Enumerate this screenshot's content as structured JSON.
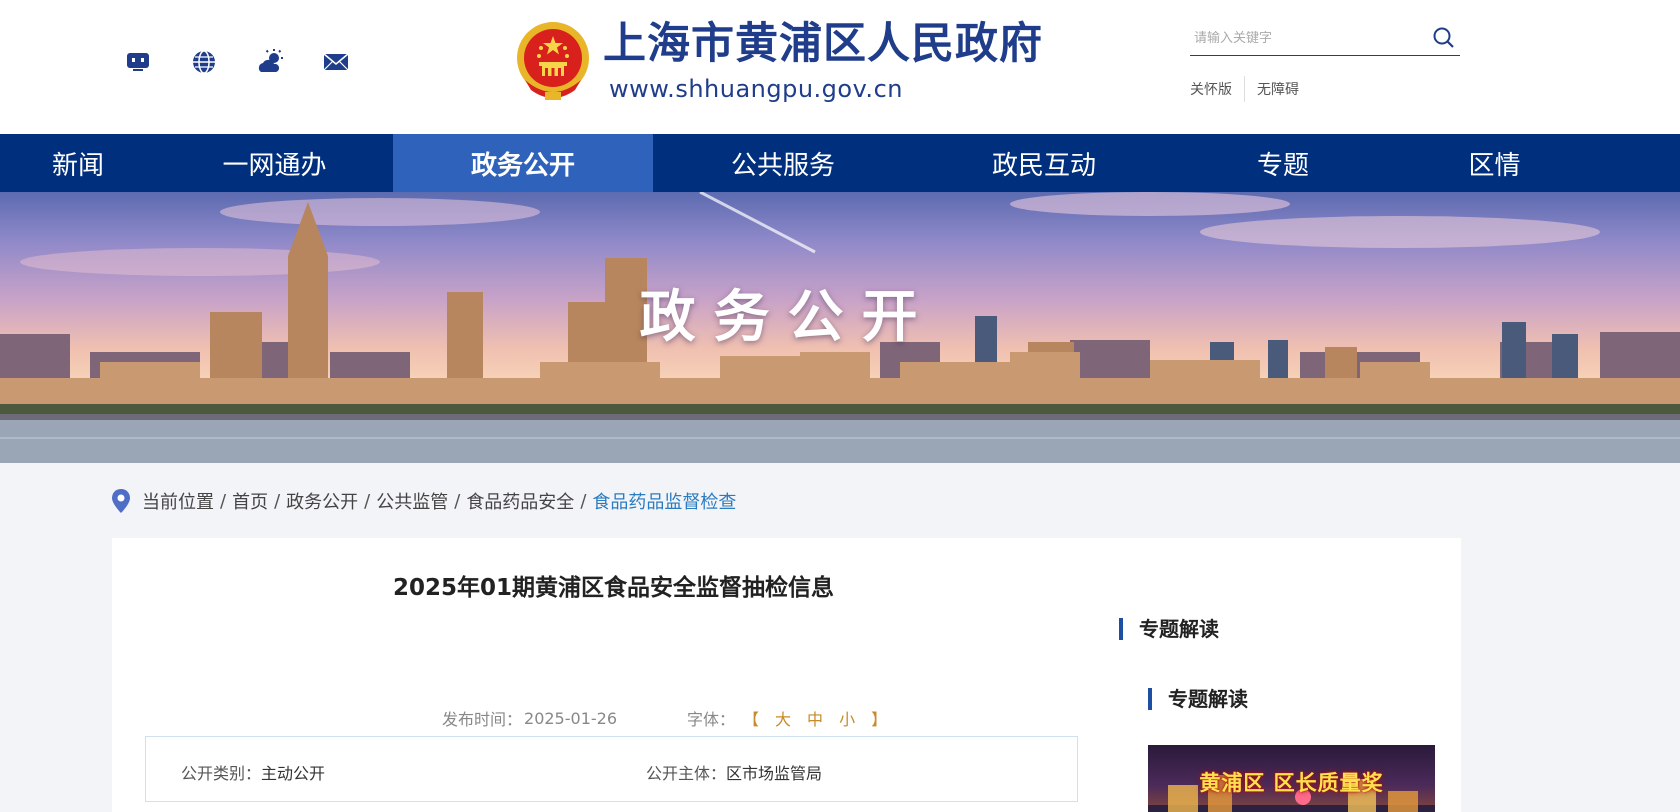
{
  "header": {
    "site_title": "上海市黄浦区人民政府",
    "site_url": "www.shhuangpu.gov.cn",
    "quick_icons": [
      "miniprogram-icon",
      "globe-icon",
      "weather-icon",
      "mail-icon"
    ],
    "search": {
      "placeholder": "请输入关键字"
    },
    "links": {
      "care": "关怀版",
      "accessibility": "无障碍"
    }
  },
  "nav": {
    "items": [
      {
        "label": "新闻"
      },
      {
        "label": "一网通办"
      },
      {
        "label": "政务公开",
        "active": true
      },
      {
        "label": "公共服务"
      },
      {
        "label": "政民互动"
      },
      {
        "label": "专题"
      },
      {
        "label": "区情"
      }
    ]
  },
  "banner": {
    "title": "政务公开"
  },
  "breadcrumb": {
    "prefix": "当前位置",
    "items": [
      "首页",
      "政务公开",
      "公共监管",
      "食品药品安全"
    ],
    "current": "食品药品监督检查"
  },
  "article": {
    "title": "2025年01期黄浦区食品安全监督抽检信息",
    "publish_label": "发布时间：",
    "publish_date": "2025-01-26",
    "font_label": "字体：",
    "font_open": "【",
    "font_close": "】",
    "font_sizes": [
      "大",
      "中",
      "小"
    ],
    "info": {
      "category_label": "公开类别：",
      "category_value": "主动公开",
      "subject_label": "公开主体：",
      "subject_value": "区市场监管局"
    }
  },
  "sidebar": {
    "heading1": "专题解读",
    "heading2": "专题解读",
    "promo_text": "黄浦区 区长质量奖"
  },
  "colors": {
    "brand": "#1f3d8a",
    "nav_bg": "#002f7d",
    "nav_active": "#2f62bb",
    "link": "#2a7bc0"
  }
}
